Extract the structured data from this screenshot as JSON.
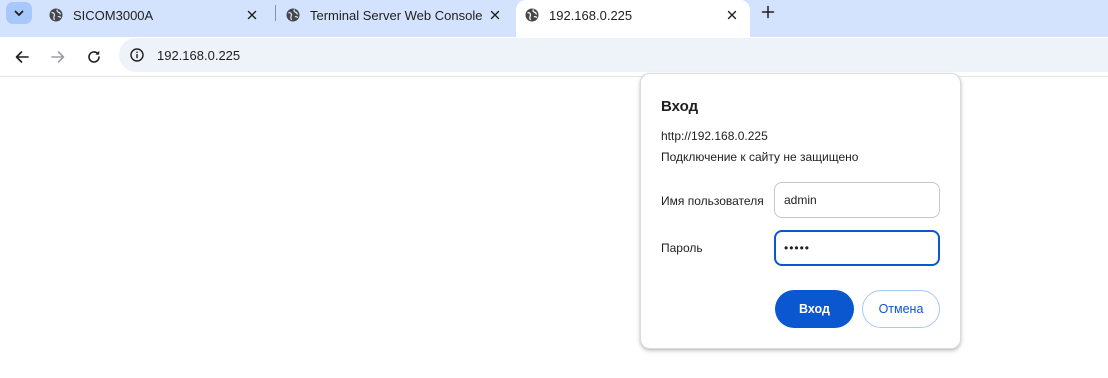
{
  "browser": {
    "tabs": [
      {
        "title": "SICOM3000A",
        "icon": "globe-icon",
        "active": false
      },
      {
        "title": "Terminal Server Web Console",
        "icon": "globe-icon",
        "active": false
      },
      {
        "title": "192.168.0.225",
        "icon": "globe-icon",
        "active": true
      }
    ],
    "address_bar": {
      "url": "192.168.0.225"
    },
    "colors": {
      "tabstrip": "#d3e3fd",
      "omnibox": "#eef2f9",
      "accent": "#0b57d0"
    }
  },
  "login_dialog": {
    "title": "Вход",
    "origin": "http://192.168.0.225",
    "warning": "Подключение к сайту не защищено",
    "username_label": "Имя пользователя",
    "username_value": "admin",
    "password_label": "Пароль",
    "password_value": "•••••",
    "ok_label": "Вход",
    "cancel_label": "Отмена"
  }
}
